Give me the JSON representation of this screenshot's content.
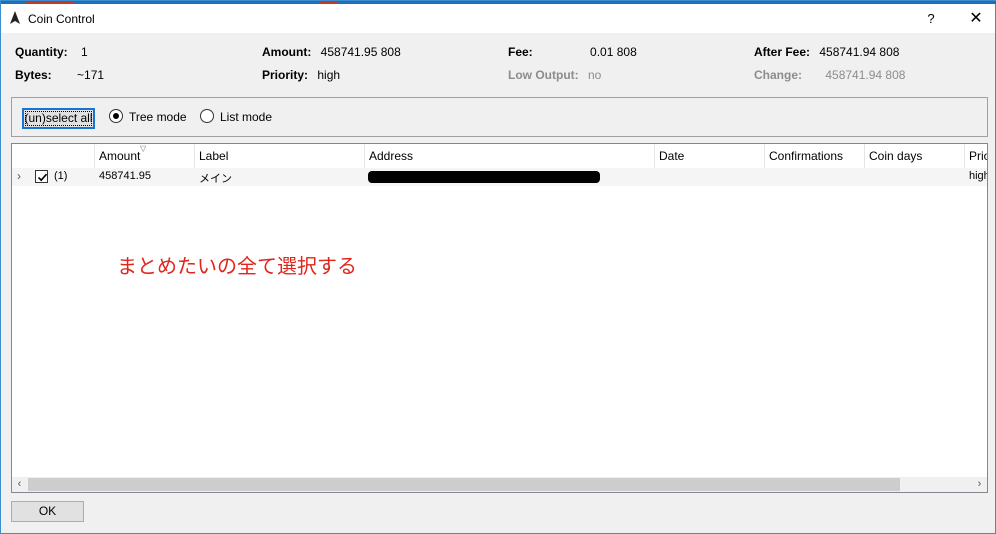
{
  "window": {
    "title": "Coin Control",
    "help": "?",
    "close": "✕"
  },
  "summary": {
    "quantity": {
      "label": "Quantity:",
      "value": "1"
    },
    "bytes": {
      "label": "Bytes:",
      "value": "~171"
    },
    "amount": {
      "label": "Amount:",
      "value": "458741.95 808"
    },
    "priority": {
      "label": "Priority:",
      "value": "high"
    },
    "fee": {
      "label": "Fee:",
      "value": "0.01 808"
    },
    "low_output": {
      "label": "Low Output:",
      "value": "no"
    },
    "after_fee": {
      "label": "After Fee:",
      "value": "458741.94 808"
    },
    "change": {
      "label": "Change:",
      "value": "458741.94 808"
    }
  },
  "mode": {
    "select_all": "(un)select all",
    "tree_mode": "Tree mode",
    "list_mode": "List mode",
    "selected": "tree"
  },
  "table": {
    "columns": [
      "Amount",
      "Label",
      "Address",
      "Date",
      "Confirmations",
      "Coin days",
      "Prio"
    ],
    "rows": [
      {
        "checked": true,
        "count": "(1)",
        "amount": "458741.95",
        "label": "メイン",
        "address": "",
        "date": "",
        "confirmations": "",
        "coin_days": "",
        "priority": "high"
      }
    ]
  },
  "annotation": "まとめたいの全て選択する",
  "footer": {
    "ok": "OK"
  },
  "colors": {
    "annotation": "#e0261b",
    "focus": "#1874d1"
  }
}
